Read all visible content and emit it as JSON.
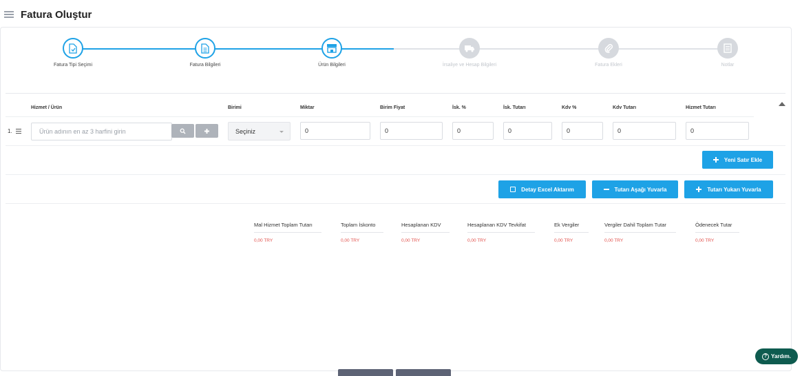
{
  "page": {
    "title": "Fatura Oluştur"
  },
  "steps": [
    {
      "label": "Fatura Tipi Seçimi",
      "icon": "document-check-icon",
      "state": "active"
    },
    {
      "label": "Fatura Bilgileri",
      "icon": "document-lines-icon",
      "state": "active"
    },
    {
      "label": "Ürün Bilgileri",
      "icon": "store-icon",
      "state": "current"
    },
    {
      "label": "İrsaliye ve Hesap Bilgileri",
      "icon": "truck-icon",
      "state": "inactive"
    },
    {
      "label": "Fatura Ekleri",
      "icon": "paperclip-icon",
      "state": "inactive"
    },
    {
      "label": "Notlar",
      "icon": "notes-icon",
      "state": "inactive"
    }
  ],
  "table": {
    "headers": {
      "product": "Hizmet / Ürün",
      "unit": "Birimi",
      "quantity": "Miktar",
      "unit_price": "Birim Fiyat",
      "discount_pct": "İsk. %",
      "discount_amount": "İsk. Tutarı",
      "vat_pct": "Kdv %",
      "vat_amount": "Kdv Tutarı",
      "service_amount": "Hizmet Tutarı"
    },
    "row": {
      "number": "1.",
      "product_placeholder": "Ürün adının en az 3 harfini girin",
      "unit_selected": "Seçiniz",
      "quantity": "0",
      "unit_price": "0",
      "discount_pct": "0",
      "discount_amount": "0",
      "vat_pct": "0",
      "vat_amount": "0",
      "service_amount": "0"
    }
  },
  "buttons": {
    "new_row": "Yeni Satır Ekle",
    "excel": "Detay Excel Aktarım",
    "round_down": "Tutarı Aşağı Yuvarla",
    "round_up": "Tutarı Yukarı Yuvarla"
  },
  "summary": {
    "labels": [
      "Mal Hizmet Toplam Tutarı",
      "Toplam İskonto",
      "Hesaplanan KDV",
      "Hesaplanan KDV Tevkifat",
      "Ek Vergiler",
      "Vergiler Dahil Toplam Tutar",
      "Ödenecek Tutar"
    ],
    "values": [
      "0,00 TRY",
      "0,00 TRY",
      "0,00 TRY",
      "0,00 TRY",
      "0,00 TRY",
      "0,00 TRY",
      "0,00 TRY"
    ]
  },
  "help": {
    "label": "Yardım."
  },
  "colors": {
    "accent": "#1ea2e6",
    "inactive": "#d6d9de",
    "amount": "#e2514c",
    "help_bg": "#0e5b4f"
  }
}
